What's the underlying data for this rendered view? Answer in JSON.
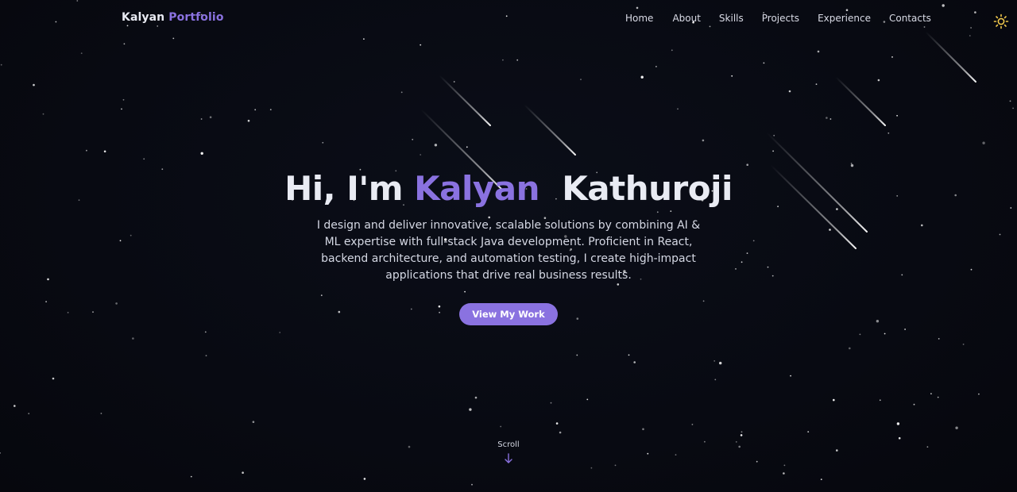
{
  "brand": {
    "part1": "Kalyan",
    "part2": "Portfolio"
  },
  "nav": {
    "items": [
      {
        "label": "Home"
      },
      {
        "label": "About"
      },
      {
        "label": "Skills"
      },
      {
        "label": "Projects"
      },
      {
        "label": "Experience"
      },
      {
        "label": "Contacts"
      }
    ],
    "theme_toggle_icon": "sun-icon"
  },
  "hero": {
    "greeting": "Hi, I'm",
    "first_name": "Kalyan",
    "last_name": "Kathuroji",
    "description": "I design and deliver innovative, scalable solutions by combining AI & ML expertise with full-stack Java development. Proficient in React, backend architecture, and automation testing, I create high-impact applications that drive real business results.",
    "cta_label": "View My Work"
  },
  "scroll": {
    "label": "Scroll",
    "icon": "arrow-down-icon"
  },
  "colors": {
    "accent": "#8a72e0",
    "background": "#080a12",
    "text": "#e6e8f0",
    "sun": "#f2c94c"
  }
}
